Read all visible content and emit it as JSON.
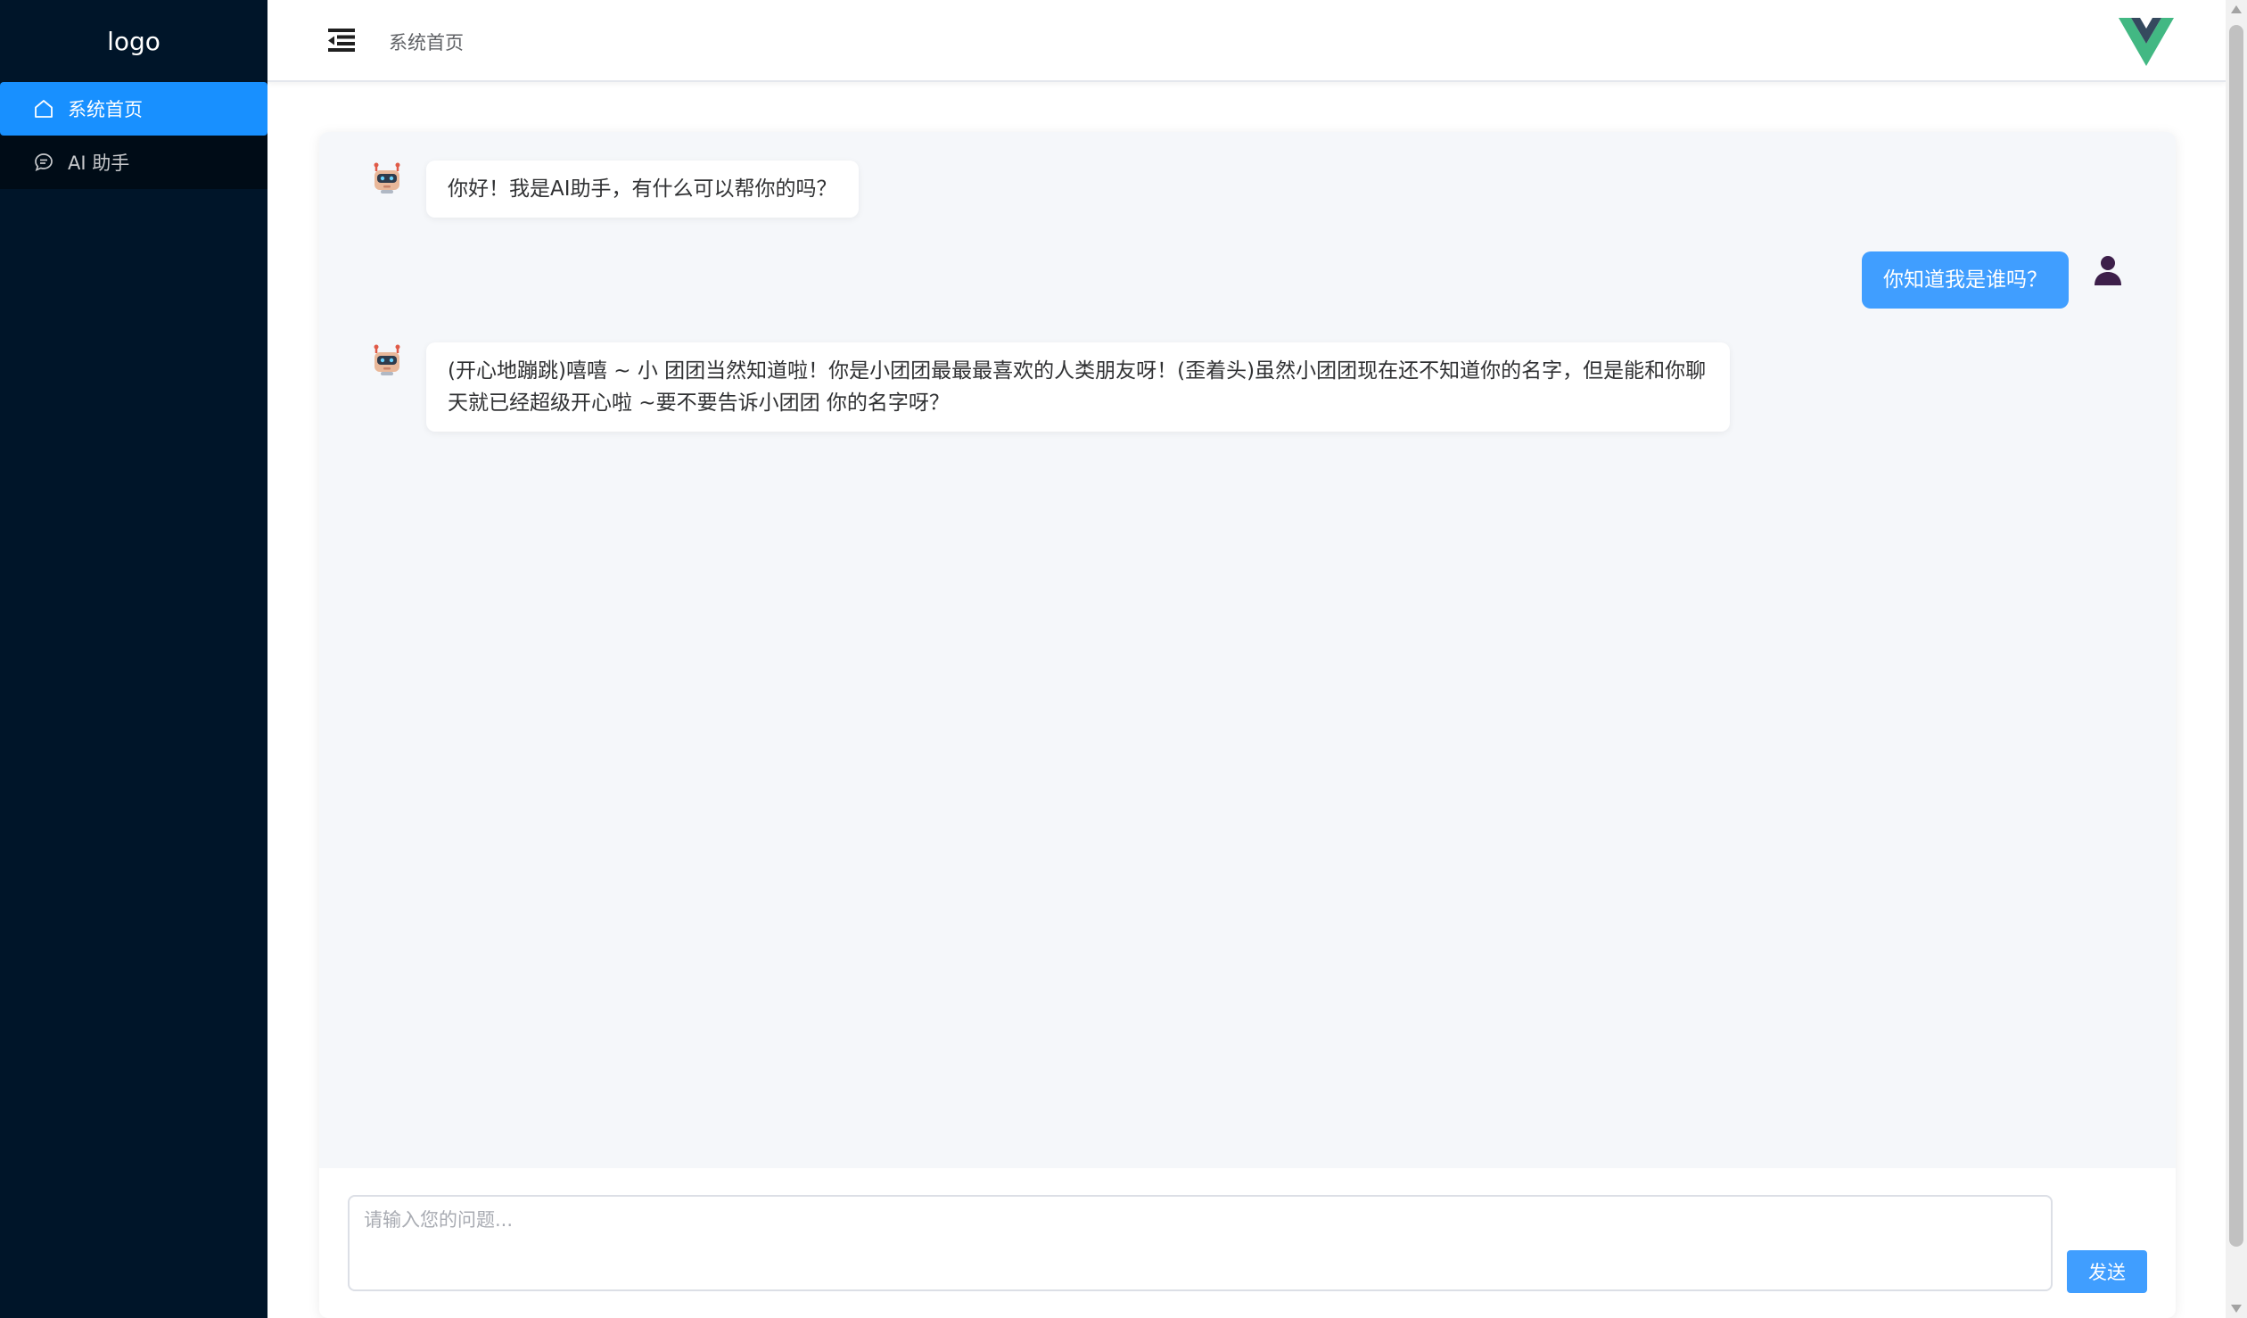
{
  "sidebar": {
    "logo": "logo",
    "items": [
      {
        "label": "系统首页",
        "icon": "home-icon",
        "active": true
      },
      {
        "label": "AI 助手",
        "icon": "chat-icon",
        "active": false
      }
    ]
  },
  "header": {
    "breadcrumb": "系统首页",
    "menu_icon": "menu-fold-icon",
    "brand_icon": "vue-logo-icon"
  },
  "chat": {
    "messages": [
      {
        "role": "bot",
        "text": "你好！我是AI助手，有什么可以帮你的吗？"
      },
      {
        "role": "user",
        "text": "你知道我是谁吗？"
      },
      {
        "role": "bot",
        "text": "(开心地蹦跳)嘻嘻 ~ 小 团团当然知道啦！你是小团团最最最喜欢的人类朋友呀！(歪着头)虽然小团团现在还不知道你的名字，但是能和你聊天就已经超级开心啦 ~要不要告诉小团团 你的名字呀？"
      }
    ],
    "input_placeholder": "请输入您的问题...",
    "input_value": "",
    "send_label": "发送"
  },
  "colors": {
    "sidebar_bg": "#001529",
    "active_menu": "#1890ff",
    "user_bubble": "#409eff",
    "chat_bg": "#f5f7fa",
    "vue_green": "#42b883",
    "vue_dark": "#35495e"
  }
}
